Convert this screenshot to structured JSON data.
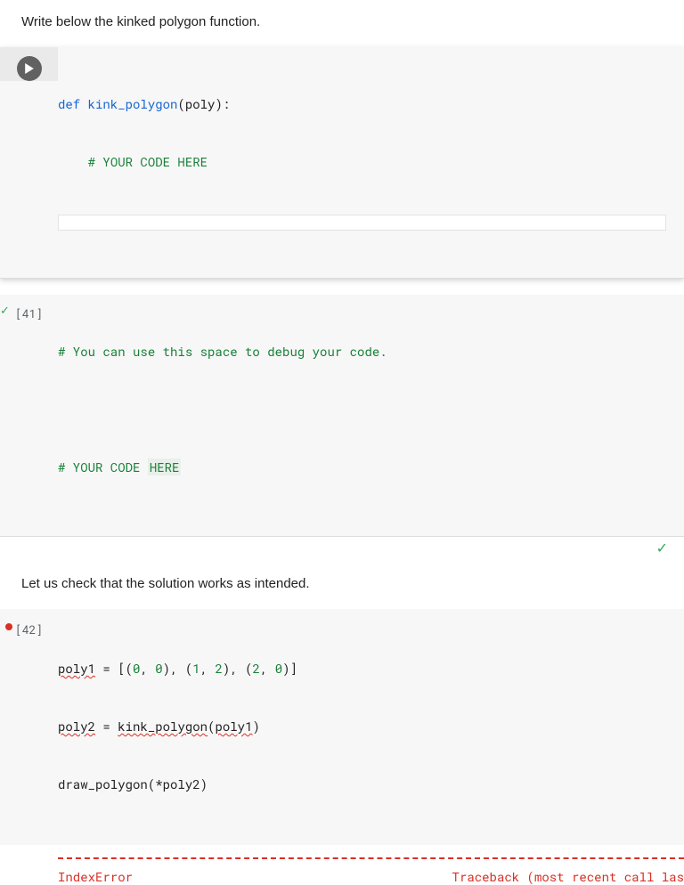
{
  "markdown": {
    "intro": "Write below the kinked polygon function.",
    "check": "Let us check that the solution works as intended."
  },
  "cells": {
    "a": {
      "prompt": "",
      "line1_kw": "def",
      "line1_fn": " kink_polygon",
      "line1_tail": "(poly):",
      "line2_indent": "    ",
      "line2_comment": "# YOUR CODE HERE"
    },
    "b": {
      "prompt": "[41]",
      "line1": "# You can use this space to debug your code.",
      "line3_pre": "# YOUR CODE ",
      "line3_here": "HERE"
    },
    "c": {
      "prompt": "[42]",
      "l1_a": "poly1",
      "l1_b": " = [(",
      "l1_n0": "0",
      "l1_c": ", ",
      "l1_n1": "0",
      "l1_d": "), (",
      "l1_n2": "1",
      "l1_e": ", ",
      "l1_n3": "2",
      "l1_f": "), (",
      "l1_n4": "2",
      "l1_g": ", ",
      "l1_n5": "0",
      "l1_h": ")]",
      "l2_a": "poly2",
      "l2_b": " = ",
      "l2_c": "kink_polygon",
      "l2_d": "(",
      "l2_e": "poly1",
      "l2_f": ")",
      "l3": "draw_polygon(*poly2)"
    }
  },
  "error": {
    "name": "IndexError",
    "trace": "Traceback (most recent call las"
  }
}
